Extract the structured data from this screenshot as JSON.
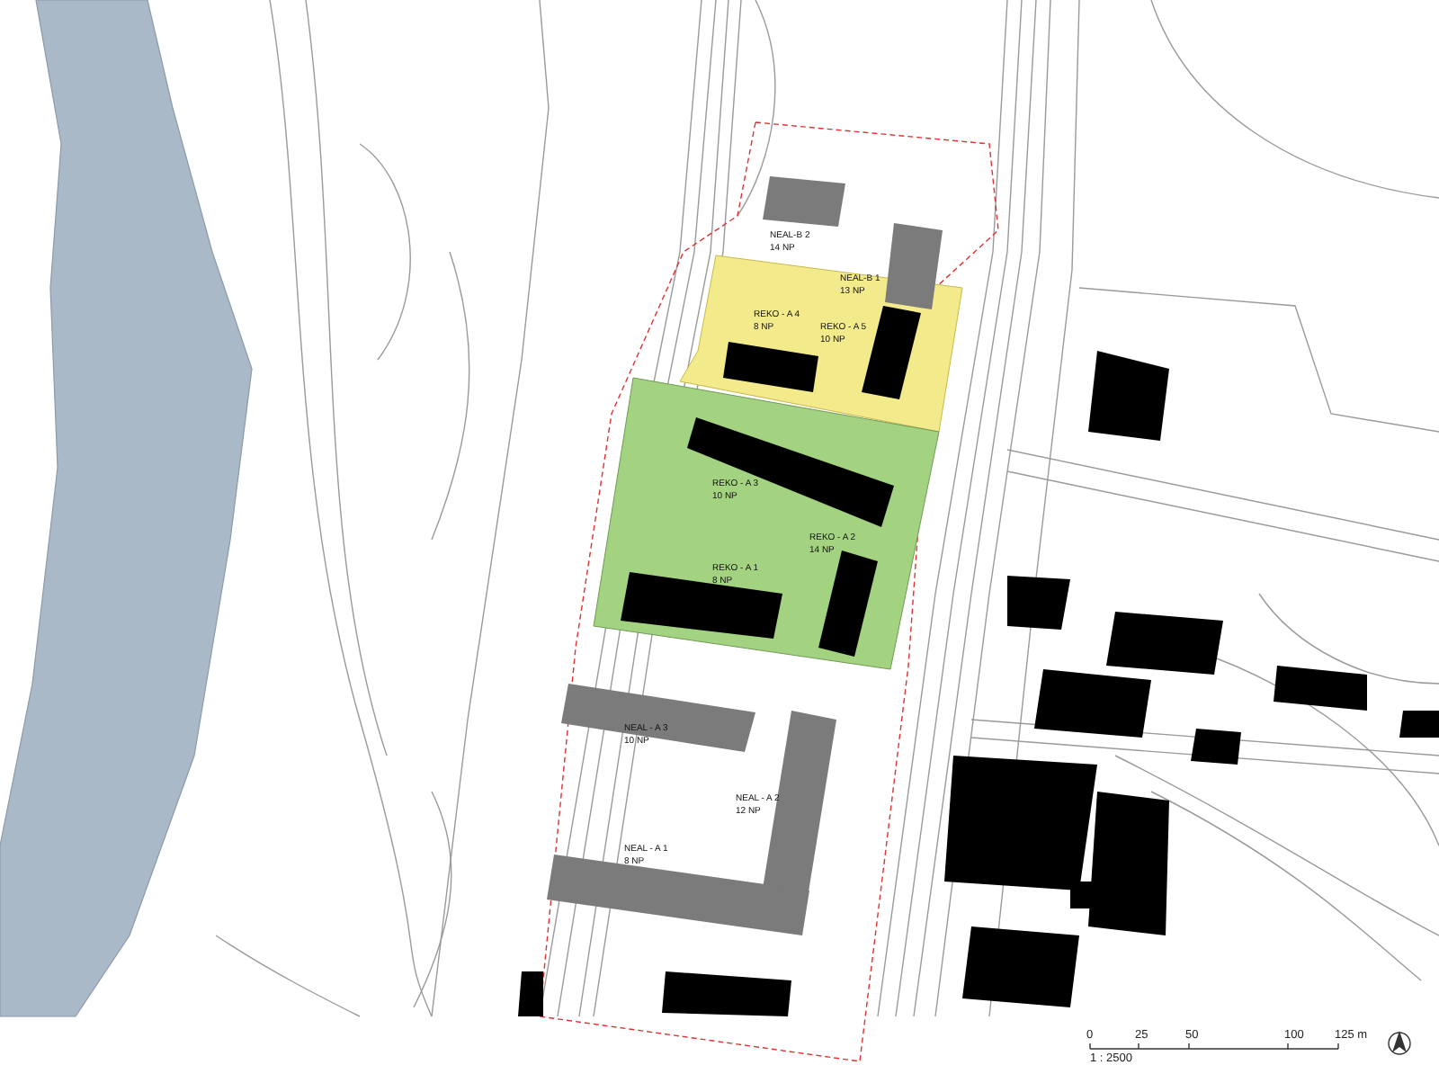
{
  "site_plan": {
    "zones": [
      {
        "kind": "yellow",
        "color": "#f3ea8c"
      },
      {
        "kind": "green",
        "color": "#a3d281"
      }
    ],
    "labels": [
      {
        "name": "NEAL-B 2",
        "floors": "14 NP"
      },
      {
        "name": "NEAL-B 1",
        "floors": "13 NP"
      },
      {
        "name": "REKO - A 4",
        "floors": "8 NP"
      },
      {
        "name": "REKO - A 5",
        "floors": "10 NP"
      },
      {
        "name": "REKO - A 3",
        "floors": "10 NP"
      },
      {
        "name": "REKO - A 2",
        "floors": "14 NP"
      },
      {
        "name": "REKO - A 1",
        "floors": "8 NP"
      },
      {
        "name": "NEAL - A 3",
        "floors": "10 NP"
      },
      {
        "name": "NEAL - A 2",
        "floors": "12 NP"
      },
      {
        "name": "NEAL - A 1",
        "floors": "8 NP"
      }
    ]
  },
  "scale_bar": {
    "ticks": [
      "0",
      "25",
      "50",
      "100",
      "125 m"
    ],
    "ratio": "1 : 2500"
  }
}
